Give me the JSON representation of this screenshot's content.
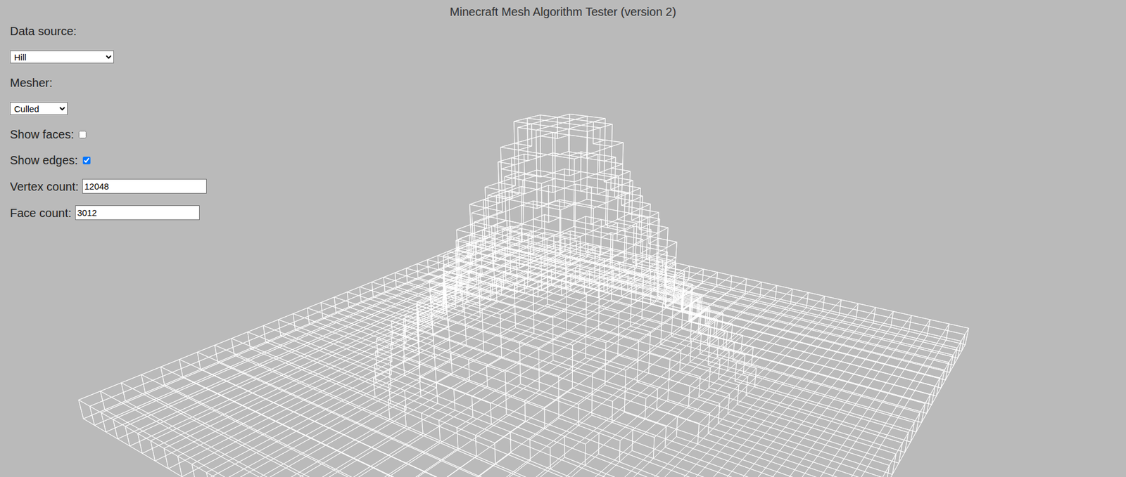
{
  "window": {
    "title": "Minecraft Mesh Algorithm Tester (version 2)"
  },
  "data_source": {
    "label": "Data source:",
    "value": "Hill"
  },
  "mesher": {
    "label": "Mesher:",
    "value": "Culled"
  },
  "show_faces": {
    "label": "Show faces:",
    "checked": false
  },
  "show_edges": {
    "label": "Show edges:",
    "checked": true
  },
  "vertex_count": {
    "label": "Vertex count:",
    "value": "12048"
  },
  "face_count": {
    "label": "Face count:",
    "value": "3012"
  }
}
